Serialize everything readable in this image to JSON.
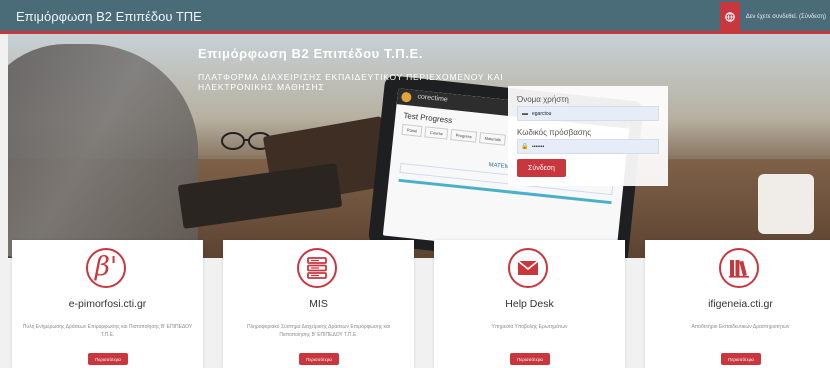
{
  "header": {
    "brand": "Επιμόρφωση Β2 Επιπέδου ΤΠΕ",
    "login_status": "Δεν έχετε συνδεθεί. (Σύνδεση)"
  },
  "hero": {
    "title": "Επιμόρφωση Β2 Επιπέδου Τ.Π.Ε.",
    "subtitle": "ΠΛΑΤΦΟΡΜΑ ΔΙΑΧΕΙΡΙΣΗΣ ΕΚΠΑΙΔΕΥΤΙΚΟΥ ΠΕΡΙΕΧΟΜΕΝΟΥ ΚΑΙ ΗΛΕΚΤΡΟΝΙΚΗΣ ΜΑΘΗΣΗΣ",
    "tablet": {
      "brand": "corectime",
      "title": "Test Progress",
      "tabs": [
        "Panel",
        "Course",
        "Progress",
        "Materials"
      ],
      "subject": "MATEMATICA"
    }
  },
  "login": {
    "username_label": "Όνομα χρήστη",
    "username_value": "egarctou",
    "password_label": "Κωδικός πρόσβασης",
    "password_value": "•••••••",
    "submit_label": "Σύνδεση"
  },
  "cards": [
    {
      "icon": "beta-icon",
      "title": "e-pimorfosi.cti.gr",
      "desc": "Πύλη Ενημέρωσης Δράσεων Επιμόρφωσης και Πιστοποίησης Β' ΕΠΙΠΕΔΟΥ Τ.Π.Ε.",
      "button": "Περισσότερα"
    },
    {
      "icon": "server-icon",
      "title": "MIS",
      "desc": "Πληροφοριακό Σύστημα Διαχείρισης Δράσεων Επιμόρφωσης και Πιστοποίησης Β' ΕΠΙΠΕΔΟΥ Τ.Π.Ε.",
      "button": "Περισσότερα"
    },
    {
      "icon": "envelope-icon",
      "title": "Help Desk",
      "desc": "Υπηρεσία Υποβολής Ερωτημάτων",
      "button": "Περισσότερα"
    },
    {
      "icon": "library-icon",
      "title": "ifigeneia.cti.gr",
      "desc": "Αποθετήριο Εκπαιδευτικών Δραστηριοτήτων",
      "button": "Περισσότερα"
    }
  ],
  "colors": {
    "topbar": "#4a6b78",
    "accent": "#c8373e"
  }
}
